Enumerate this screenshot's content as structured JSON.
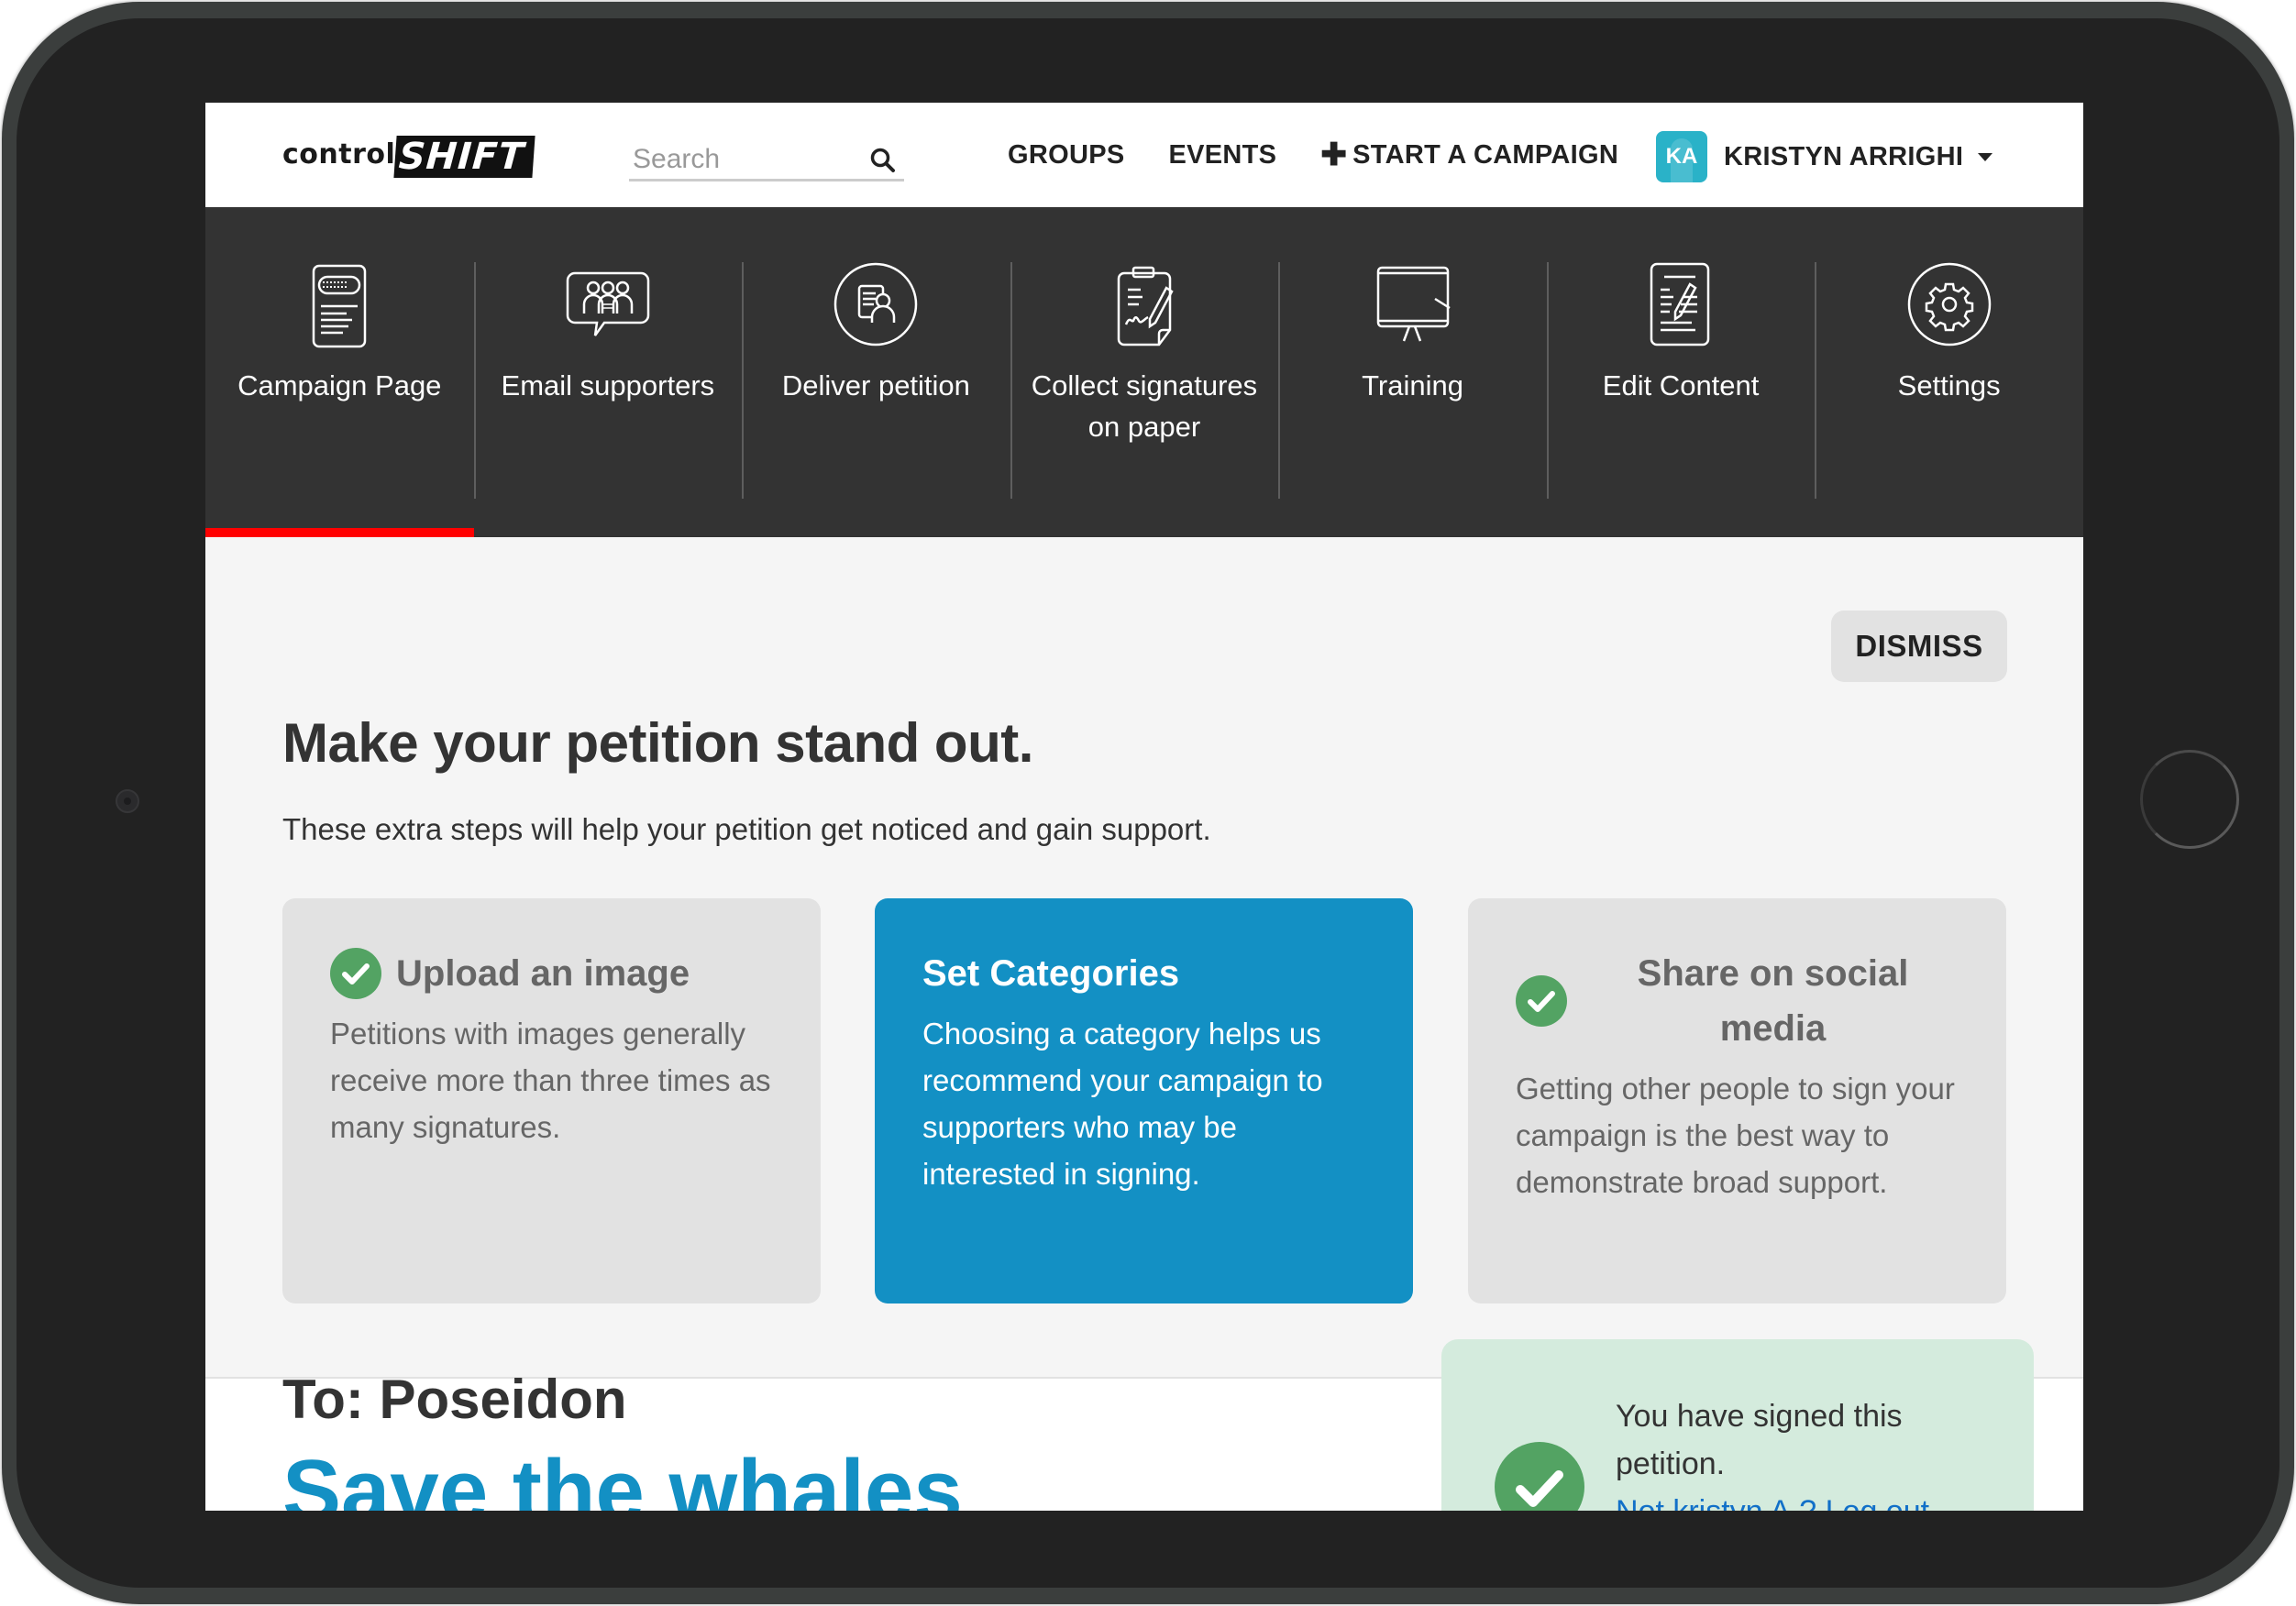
{
  "brand": {
    "logo_left": "control",
    "logo_right": "SHIFT"
  },
  "header": {
    "search": {
      "placeholder": "Search",
      "value": "",
      "icon": "search-icon"
    },
    "links": [
      {
        "label": "GROUPS"
      },
      {
        "label": "EVENTS"
      },
      {
        "label": "START A CAMPAIGN",
        "icon": "plus-icon"
      }
    ],
    "user": {
      "initials": "KA",
      "name": "KRISTYN ARRIGHI",
      "avatar_color": "#2ab2c8"
    }
  },
  "tabs": [
    {
      "label": "Campaign Page",
      "icon": "campaign-page-icon",
      "active": true
    },
    {
      "label": "Email supporters",
      "icon": "email-supporters-icon",
      "active": false
    },
    {
      "label": "Deliver petition",
      "icon": "deliver-petition-icon",
      "active": false
    },
    {
      "label": "Collect signatures on paper",
      "icon": "clipboard-signature-icon",
      "active": false
    },
    {
      "label": "Training",
      "icon": "presentation-board-icon",
      "active": false
    },
    {
      "label": "Edit Content",
      "icon": "edit-document-icon",
      "active": false
    },
    {
      "label": "Settings",
      "icon": "gear-icon",
      "active": false
    }
  ],
  "prompt": {
    "title": "Make your petition stand out.",
    "subtitle": "These extra steps will help your petition get noticed and gain support.",
    "dismiss_label": "DISMISS",
    "cards": [
      {
        "title": "Upload an image",
        "body": "Petitions with images generally receive more than three times as many signatures.",
        "completed": true
      },
      {
        "title": "Set Categories",
        "body": "Choosing a category helps us recommend your campaign to supporters who may be interested in signing.",
        "completed": false
      },
      {
        "title": "Share on social media",
        "body": "Getting other people to sign your campaign is the best way to demonstrate broad support.",
        "completed": true
      }
    ]
  },
  "petition": {
    "to": "To: Poseidon",
    "title": "Save the whales",
    "signed_message": "You have signed this petition.",
    "not_you_link": "Not kristyn A.? Log out"
  },
  "colors": {
    "accent_blue": "#1390c4",
    "active_tab_underline": "#ff0000",
    "success_green": "#53a363",
    "nav_dark": "#333333"
  }
}
